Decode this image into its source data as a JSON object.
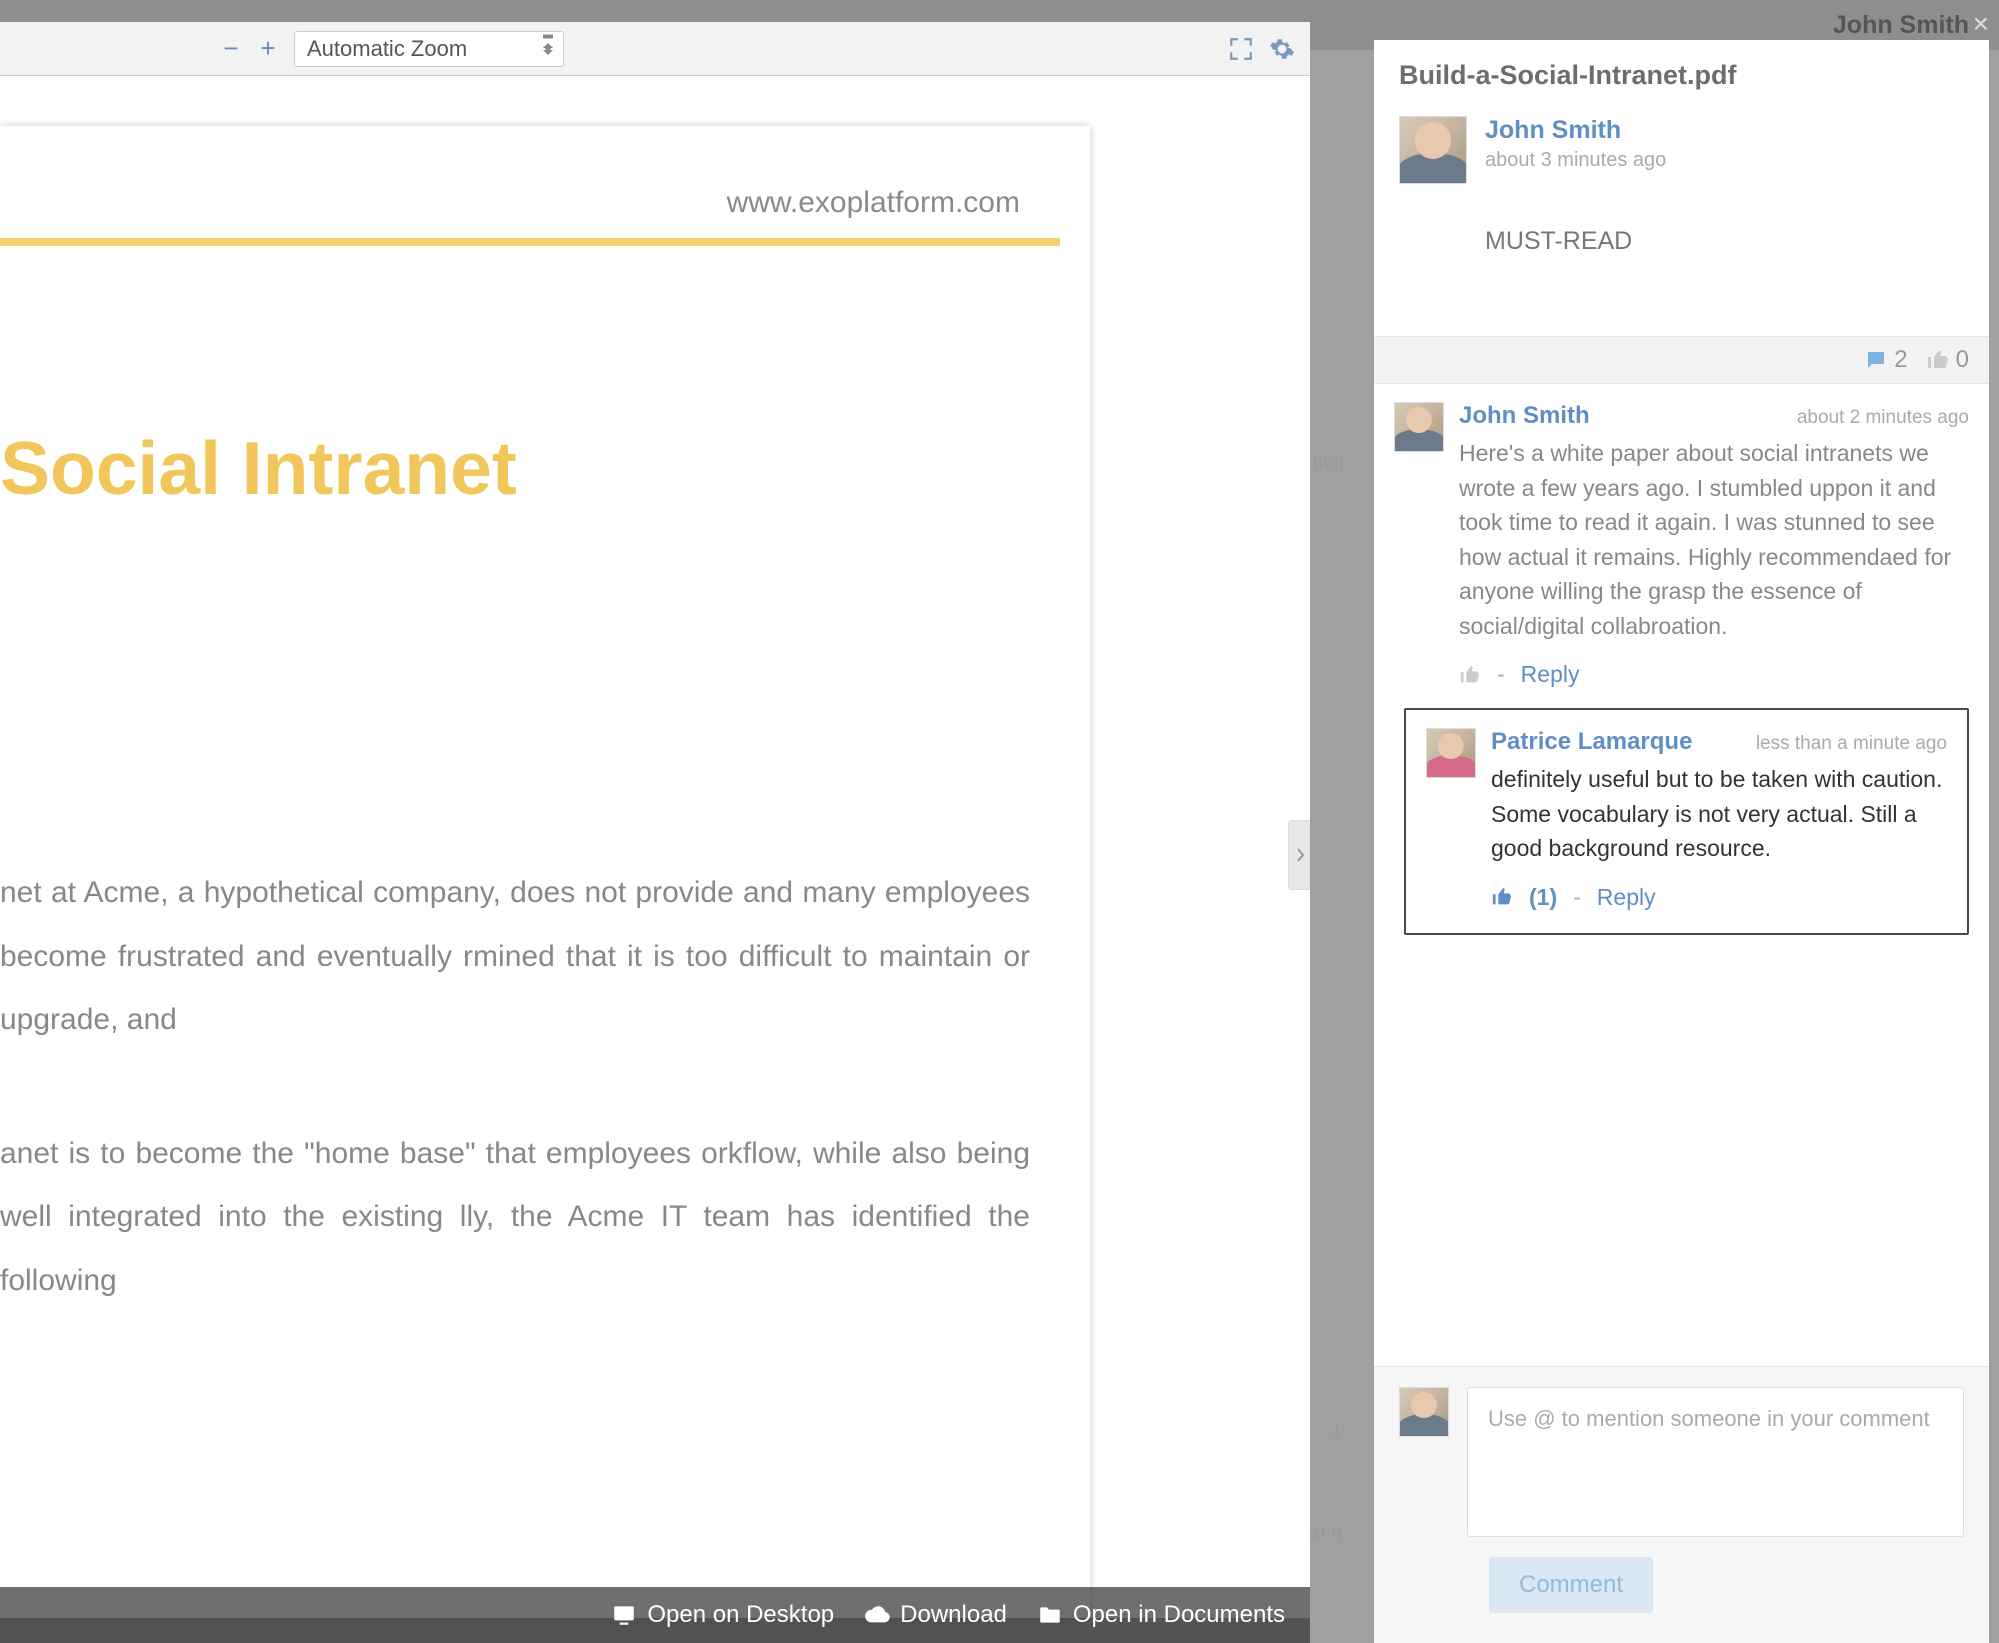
{
  "topbar": {
    "user": "John Smith"
  },
  "close_label": "×",
  "viewer": {
    "zoom_label": "Automatic Zoom",
    "doc": {
      "url": "www.exoplatform.com",
      "title": " Social Intranet",
      "para1": "net at Acme, a hypothetical company, does not provide and many employees become frustrated and eventually rmined that it is too difficult to maintain or upgrade, and",
      "para2": "anet is to become the \"home base\" that employees orkflow, while also being well integrated into the existing lly, the Acme IT team has identified the following"
    }
  },
  "bottombar": {
    "open_desktop": "Open on Desktop",
    "download": "Download",
    "open_docs": "Open in Documents"
  },
  "panel": {
    "title": "Build-a-Social-Intranet.pdf",
    "post": {
      "author": "John Smith",
      "time": "about 3 minutes ago",
      "body": "MUST-READ"
    },
    "stats": {
      "comments": "2",
      "likes": "0"
    },
    "comments": [
      {
        "author": "John Smith",
        "time": "about 2 minutes ago",
        "text": "Here's a white paper about social intranets we wrote a few years ago. I stumbled uppon it and took time to read it again. I was stunned to see how actual it remains. Highly recommendaed for anyone willing the grasp the essence of social/digital collabroation.",
        "reply": "Reply",
        "sep": "-"
      }
    ],
    "nested": {
      "author": "Patrice Lamarque",
      "time": "less than a minute ago",
      "text": "definitely useful but to be taken with caution. Some vocabulary is not very actual. Still a good background resource.",
      "like_count": "(1)",
      "sep": "-",
      "reply": "Reply"
    },
    "compose": {
      "placeholder": "Use @ to mention someone in your comment",
      "button": "Comment"
    }
  },
  "bg": {
    "tivi": "tivit",
    "one": "1",
    "alit": "al it"
  }
}
